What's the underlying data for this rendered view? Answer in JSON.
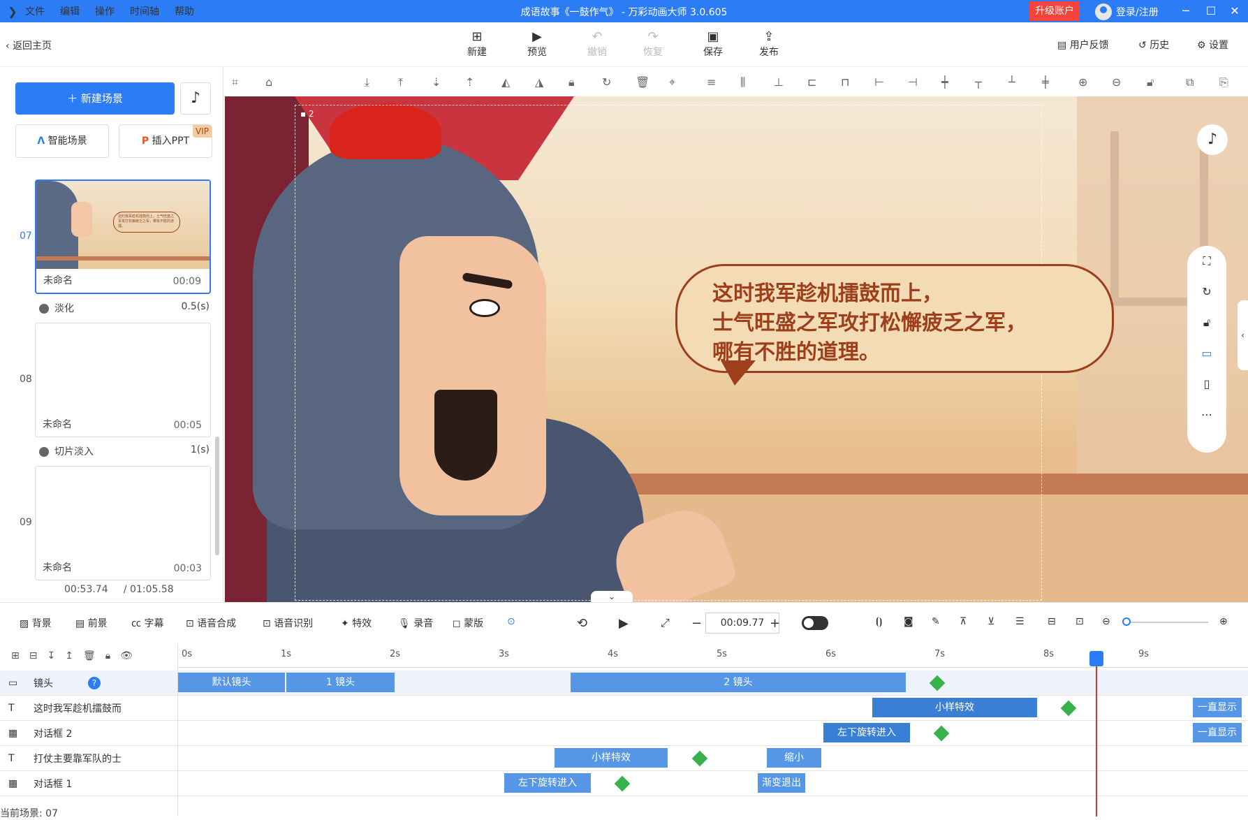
{
  "app": {
    "menu": [
      "文件",
      "编辑",
      "操作",
      "时间轴",
      "帮助"
    ],
    "title": "成语故事《一鼓作气》 - 万彩动画大师 3.0.605",
    "upgrade": "升级账户",
    "login": "登录/注册"
  },
  "toolbar": {
    "back": "返回主页",
    "buttons": [
      {
        "label": "新建",
        "icon": "plus-icon"
      },
      {
        "label": "预览",
        "icon": "play-icon"
      },
      {
        "label": "撤销",
        "icon": "undo-icon"
      },
      {
        "label": "恢复",
        "icon": "redo-icon"
      },
      {
        "label": "保存",
        "icon": "save-icon"
      },
      {
        "label": "发布",
        "icon": "publish-icon"
      }
    ],
    "right": [
      "用户反馈",
      "历史",
      "设置"
    ]
  },
  "left": {
    "new_scene": "新建场景",
    "smart_scene": "智能场景",
    "insert_ppt": "插入PPT",
    "vip": "VIP",
    "scenes": [
      {
        "num": "07",
        "name": "未命名",
        "time": "00:09",
        "selected": true
      },
      {
        "num": "08",
        "name": "未命名",
        "time": "00:05",
        "selected": false
      },
      {
        "num": "09",
        "name": "未命名",
        "time": "00:03",
        "selected": false
      }
    ],
    "transitions": [
      {
        "name": "淡化",
        "dur": "0.5(s)"
      },
      {
        "name": "切片淡入",
        "dur": "1(s)"
      }
    ],
    "current_time": "00:53.74",
    "total_time": "/ 01:05.58"
  },
  "canvas": {
    "camera_label": "2",
    "bubble_lines": [
      "这时我军趁机擂鼓而上，",
      "士气旺盛之军攻打松懈疲乏之军，",
      "哪有不胜的道理。"
    ],
    "thumb_text": "这时我军趁机擂鼓而上，士气旺盛之军攻打松懈疲乏之军，哪有不胜的道理。"
  },
  "bottom": {
    "tools": [
      "背景",
      "前景",
      "字幕",
      "语音合成",
      "语音识别",
      "特效",
      "录音",
      "蒙版"
    ],
    "time": "00:09.77"
  },
  "timeline": {
    "ticks": [
      "0s",
      "1s",
      "2s",
      "3s",
      "4s",
      "5s",
      "6s",
      "7s",
      "8s",
      "9s"
    ],
    "tracks": [
      {
        "label": "镜头",
        "bars": [
          "默认镜头",
          "1 镜头",
          "2 镜头"
        ]
      },
      {
        "label": "这时我军趁机擂鼓而",
        "bars": [
          "小样特效",
          "一直显示"
        ]
      },
      {
        "label": "对话框 2",
        "bars": [
          "左下旋转进入",
          "一直显示"
        ]
      },
      {
        "label": "打仗主要靠军队的士",
        "bars": [
          "小样特效",
          "缩小"
        ]
      },
      {
        "label": "对话框 1",
        "bars": [
          "左下旋转进入",
          "渐变退出"
        ]
      }
    ],
    "current_scene": "当前场景: 07"
  }
}
